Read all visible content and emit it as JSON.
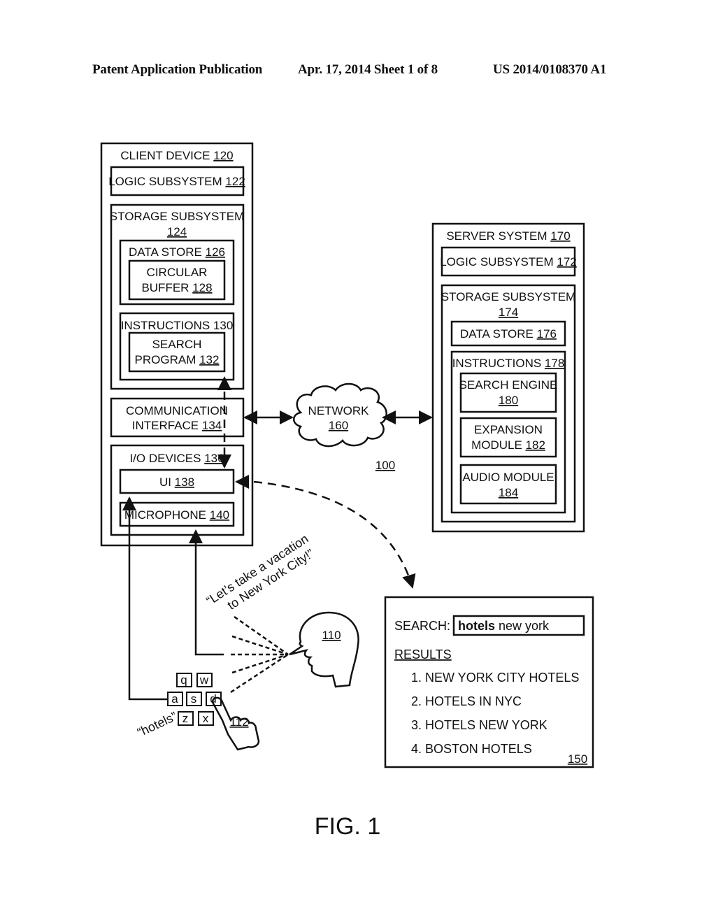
{
  "header": {
    "left": "Patent Application Publication",
    "middle": "Apr. 17, 2014  Sheet 1 of 8",
    "right": "US 2014/0108370 A1"
  },
  "client": {
    "title": "CLIENT DEVICE ",
    "title_ref": "120",
    "logic": "LOGIC SUBSYSTEM ",
    "logic_ref": "122",
    "storage": "STORAGE SUBSYSTEM",
    "storage_ref": "124",
    "datastore": "DATA STORE ",
    "datastore_ref": "126",
    "buffer_l1": "CIRCULAR",
    "buffer_l2": "BUFFER ",
    "buffer_ref": "128",
    "instructions": "INSTRUCTIONS 130",
    "search_l1": "SEARCH",
    "search_l2": "PROGRAM ",
    "search_ref": "132",
    "comm_l1": "COMMUNICATION",
    "comm_l2": "INTERFACE ",
    "comm_ref": "134",
    "io": "I/O DEVICES ",
    "io_ref": "136",
    "ui": "UI ",
    "ui_ref": "138",
    "mic": "MICROPHONE ",
    "mic_ref": "140"
  },
  "network": {
    "label": "NETWORK",
    "ref": "160"
  },
  "system_ref": "100",
  "server": {
    "title": "SERVER SYSTEM ",
    "title_ref": "170",
    "logic": "LOGIC SUBSYSTEM ",
    "logic_ref": "172",
    "storage": "STORAGE SUBSYSTEM",
    "storage_ref": "174",
    "datastore": "DATA STORE ",
    "datastore_ref": "176",
    "instructions": "INSTRUCTIONS ",
    "instructions_ref": "178",
    "engine": "SEARCH ENGINE",
    "engine_ref": "180",
    "expansion_l1": "EXPANSION",
    "expansion_l2": "MODULE ",
    "expansion_ref": "182",
    "audio": "AUDIO MODULE",
    "audio_ref": "184"
  },
  "speech": {
    "line1": "“Let’s take a vacation",
    "line2": "to New York City!”"
  },
  "user_ref": "110",
  "keyboard": {
    "keys_row1": [
      "q",
      "w"
    ],
    "keys_row2": [
      "a",
      "s",
      "d"
    ],
    "keys_row3": [
      "z",
      "x"
    ],
    "typed": "“hotels”",
    "hand_ref": "112"
  },
  "results_panel": {
    "search_label": "SEARCH:",
    "query_bold": "hotels",
    "query_rest": " new york",
    "results_heading": "RESULTS",
    "results": [
      "1. NEW YORK CITY HOTELS",
      "2. HOTELS IN NYC",
      "3. HOTELS NEW YORK",
      "4. BOSTON HOTELS"
    ],
    "ref": "150"
  },
  "figure_label": "FIG. 1"
}
